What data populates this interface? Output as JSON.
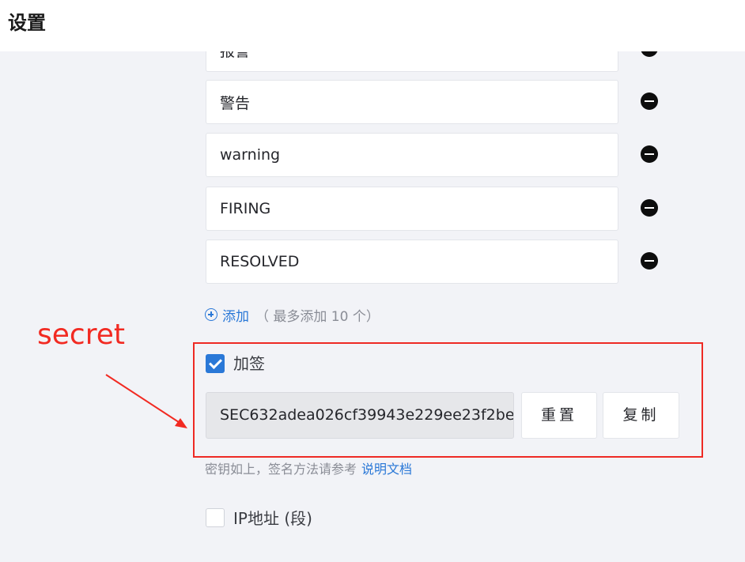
{
  "header": {
    "title": "设置"
  },
  "keywords": [
    {
      "value": "报警"
    },
    {
      "value": "警告"
    },
    {
      "value": "warning"
    },
    {
      "value": "FIRING"
    },
    {
      "value": "RESOLVED"
    }
  ],
  "add": {
    "label": "添加",
    "hint": "（ 最多添加 10 个）"
  },
  "annotation": {
    "text": "secret",
    "color": "#ee2a24"
  },
  "sign": {
    "checked": true,
    "label": "加签",
    "secret": "SEC632adea026cf39943e229ee23f2be",
    "reset_label": "重置",
    "copy_label": "复制",
    "hint": "密钥如上，签名方法请参考",
    "doc_link": "说明文档"
  },
  "ip": {
    "checked": false,
    "label": "IP地址 (段)"
  },
  "colors": {
    "accent": "#2a78d7",
    "background": "#f2f3f7"
  }
}
